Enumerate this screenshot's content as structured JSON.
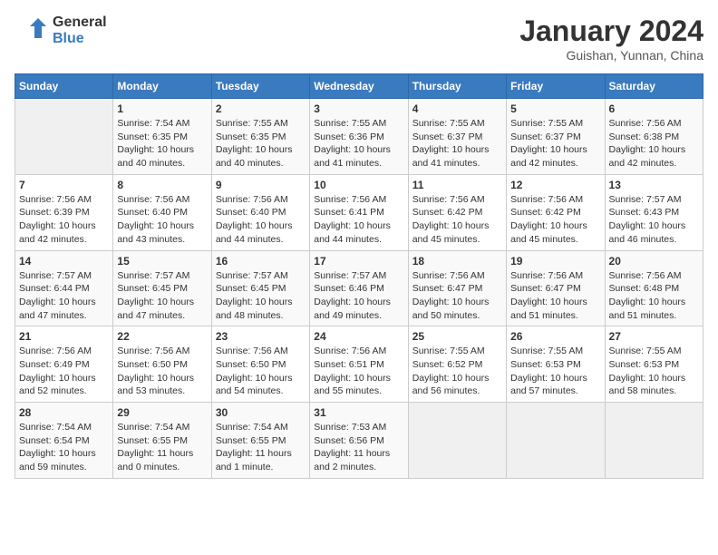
{
  "header": {
    "logo_line1": "General",
    "logo_line2": "Blue",
    "month": "January 2024",
    "location": "Guishan, Yunnan, China"
  },
  "days_of_week": [
    "Sunday",
    "Monday",
    "Tuesday",
    "Wednesday",
    "Thursday",
    "Friday",
    "Saturday"
  ],
  "weeks": [
    [
      {
        "day": "",
        "info": ""
      },
      {
        "day": "1",
        "info": "Sunrise: 7:54 AM\nSunset: 6:35 PM\nDaylight: 10 hours\nand 40 minutes."
      },
      {
        "day": "2",
        "info": "Sunrise: 7:55 AM\nSunset: 6:35 PM\nDaylight: 10 hours\nand 40 minutes."
      },
      {
        "day": "3",
        "info": "Sunrise: 7:55 AM\nSunset: 6:36 PM\nDaylight: 10 hours\nand 41 minutes."
      },
      {
        "day": "4",
        "info": "Sunrise: 7:55 AM\nSunset: 6:37 PM\nDaylight: 10 hours\nand 41 minutes."
      },
      {
        "day": "5",
        "info": "Sunrise: 7:55 AM\nSunset: 6:37 PM\nDaylight: 10 hours\nand 42 minutes."
      },
      {
        "day": "6",
        "info": "Sunrise: 7:56 AM\nSunset: 6:38 PM\nDaylight: 10 hours\nand 42 minutes."
      }
    ],
    [
      {
        "day": "7",
        "info": "Sunrise: 7:56 AM\nSunset: 6:39 PM\nDaylight: 10 hours\nand 42 minutes."
      },
      {
        "day": "8",
        "info": "Sunrise: 7:56 AM\nSunset: 6:40 PM\nDaylight: 10 hours\nand 43 minutes."
      },
      {
        "day": "9",
        "info": "Sunrise: 7:56 AM\nSunset: 6:40 PM\nDaylight: 10 hours\nand 44 minutes."
      },
      {
        "day": "10",
        "info": "Sunrise: 7:56 AM\nSunset: 6:41 PM\nDaylight: 10 hours\nand 44 minutes."
      },
      {
        "day": "11",
        "info": "Sunrise: 7:56 AM\nSunset: 6:42 PM\nDaylight: 10 hours\nand 45 minutes."
      },
      {
        "day": "12",
        "info": "Sunrise: 7:56 AM\nSunset: 6:42 PM\nDaylight: 10 hours\nand 45 minutes."
      },
      {
        "day": "13",
        "info": "Sunrise: 7:57 AM\nSunset: 6:43 PM\nDaylight: 10 hours\nand 46 minutes."
      }
    ],
    [
      {
        "day": "14",
        "info": "Sunrise: 7:57 AM\nSunset: 6:44 PM\nDaylight: 10 hours\nand 47 minutes."
      },
      {
        "day": "15",
        "info": "Sunrise: 7:57 AM\nSunset: 6:45 PM\nDaylight: 10 hours\nand 47 minutes."
      },
      {
        "day": "16",
        "info": "Sunrise: 7:57 AM\nSunset: 6:45 PM\nDaylight: 10 hours\nand 48 minutes."
      },
      {
        "day": "17",
        "info": "Sunrise: 7:57 AM\nSunset: 6:46 PM\nDaylight: 10 hours\nand 49 minutes."
      },
      {
        "day": "18",
        "info": "Sunrise: 7:56 AM\nSunset: 6:47 PM\nDaylight: 10 hours\nand 50 minutes."
      },
      {
        "day": "19",
        "info": "Sunrise: 7:56 AM\nSunset: 6:47 PM\nDaylight: 10 hours\nand 51 minutes."
      },
      {
        "day": "20",
        "info": "Sunrise: 7:56 AM\nSunset: 6:48 PM\nDaylight: 10 hours\nand 51 minutes."
      }
    ],
    [
      {
        "day": "21",
        "info": "Sunrise: 7:56 AM\nSunset: 6:49 PM\nDaylight: 10 hours\nand 52 minutes."
      },
      {
        "day": "22",
        "info": "Sunrise: 7:56 AM\nSunset: 6:50 PM\nDaylight: 10 hours\nand 53 minutes."
      },
      {
        "day": "23",
        "info": "Sunrise: 7:56 AM\nSunset: 6:50 PM\nDaylight: 10 hours\nand 54 minutes."
      },
      {
        "day": "24",
        "info": "Sunrise: 7:56 AM\nSunset: 6:51 PM\nDaylight: 10 hours\nand 55 minutes."
      },
      {
        "day": "25",
        "info": "Sunrise: 7:55 AM\nSunset: 6:52 PM\nDaylight: 10 hours\nand 56 minutes."
      },
      {
        "day": "26",
        "info": "Sunrise: 7:55 AM\nSunset: 6:53 PM\nDaylight: 10 hours\nand 57 minutes."
      },
      {
        "day": "27",
        "info": "Sunrise: 7:55 AM\nSunset: 6:53 PM\nDaylight: 10 hours\nand 58 minutes."
      }
    ],
    [
      {
        "day": "28",
        "info": "Sunrise: 7:54 AM\nSunset: 6:54 PM\nDaylight: 10 hours\nand 59 minutes."
      },
      {
        "day": "29",
        "info": "Sunrise: 7:54 AM\nSunset: 6:55 PM\nDaylight: 11 hours\nand 0 minutes."
      },
      {
        "day": "30",
        "info": "Sunrise: 7:54 AM\nSunset: 6:55 PM\nDaylight: 11 hours\nand 1 minute."
      },
      {
        "day": "31",
        "info": "Sunrise: 7:53 AM\nSunset: 6:56 PM\nDaylight: 11 hours\nand 2 minutes."
      },
      {
        "day": "",
        "info": ""
      },
      {
        "day": "",
        "info": ""
      },
      {
        "day": "",
        "info": ""
      }
    ]
  ]
}
